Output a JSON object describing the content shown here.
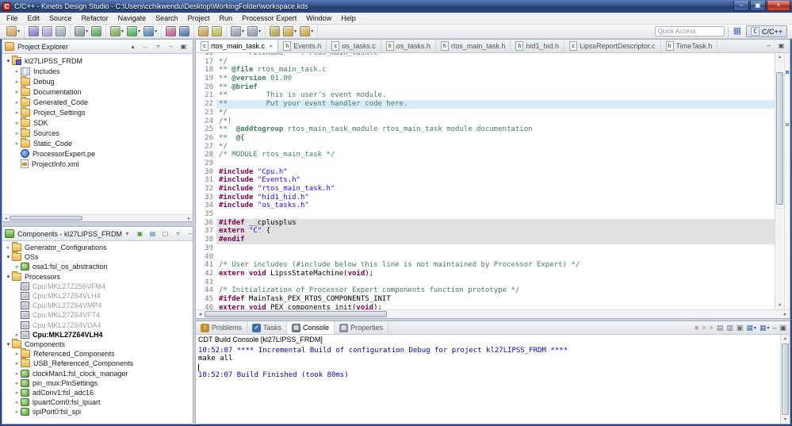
{
  "window": {
    "title": "C/C++ - Kinetis Design Studio - C:\\Users\\cchikwendu\\Desktop\\WorkingFolder\\workspace.kds",
    "app_icon": "C",
    "controls": {
      "minimize": "–",
      "maximize": "▣",
      "close": "×"
    }
  },
  "menu": {
    "items": [
      "File",
      "Edit",
      "Source",
      "Refactor",
      "Navigate",
      "Search",
      "Project",
      "Run",
      "Processor Expert",
      "Window",
      "Help"
    ]
  },
  "toolbar": {
    "quick_access_placeholder": "Quick Access",
    "perspective_label": "C/C++",
    "groups": [
      [
        {
          "name": "new-wizard-icon",
          "c": "#caa24b",
          "dd": true
        }
      ],
      [
        {
          "name": "save-icon",
          "c": "#8073c4"
        },
        {
          "name": "save-all-icon",
          "c": "#a59ad6"
        },
        {
          "name": "print-icon",
          "c": "#9aa5b5"
        }
      ],
      [
        {
          "name": "build-icon",
          "c": "#8b9098",
          "dd": true
        },
        {
          "name": "new-connection-icon",
          "c": "#55a055"
        }
      ],
      [
        {
          "name": "debug-icon",
          "c": "#74a84e",
          "dd": true
        },
        {
          "name": "run-icon",
          "c": "#43ae4d",
          "dd": true
        },
        {
          "name": "external-tools-icon",
          "c": "#4d7fb0",
          "dd": true
        }
      ],
      [
        {
          "name": "processor-expert-generate-icon",
          "c": "#b05a8c"
        },
        {
          "name": "search-icon",
          "c": "#4b6ea8"
        }
      ],
      [
        {
          "name": "open-element-icon",
          "c": "#c49a3f"
        },
        {
          "name": "mark-occurrences-icon",
          "c": "#b8b84a"
        }
      ],
      [
        {
          "name": "next-annotation-icon",
          "c": "#8a99aa",
          "dd": true
        },
        {
          "name": "previous-annotation-icon",
          "c": "#8a99aa",
          "dd": true
        }
      ],
      [
        {
          "name": "last-edit-location-icon",
          "c": "#b0a040"
        },
        {
          "name": "back-icon",
          "c": "#caa23f",
          "dd": true
        },
        {
          "name": "forward-icon",
          "c": "#caa23f",
          "dd": true
        }
      ]
    ]
  },
  "project_explorer": {
    "title": "Project Explorer",
    "header_icons": [
      {
        "name": "collapse-all-icon",
        "glyph": "▴",
        "c": "#556"
      },
      {
        "name": "link-with-editor-icon",
        "glyph": "↔",
        "c": "#b9a23f"
      },
      {
        "name": "view-menu-icon",
        "glyph": "▿",
        "c": "#556"
      },
      {
        "name": "minimize-view-icon",
        "glyph": "–",
        "c": "#556"
      },
      {
        "name": "maximize-view-icon",
        "glyph": "▣",
        "c": "#556"
      }
    ],
    "items": [
      {
        "label": "kl27LIPSS_FRDM",
        "level": 0,
        "arrow": "expanded",
        "icon": "project"
      },
      {
        "label": "Includes",
        "level": 1,
        "arrow": "collapsed",
        "icon": "includes"
      },
      {
        "label": "Debug",
        "level": 1,
        "arrow": "collapsed",
        "icon": "folder"
      },
      {
        "label": "Documentation",
        "level": 1,
        "arrow": "collapsed",
        "icon": "folder"
      },
      {
        "label": "Generated_Code",
        "level": 1,
        "arrow": "collapsed",
        "icon": "folder"
      },
      {
        "label": "Project_Settings",
        "level": 1,
        "arrow": "collapsed",
        "icon": "folder"
      },
      {
        "label": "SDK",
        "level": 1,
        "arrow": "collapsed",
        "icon": "folder"
      },
      {
        "label": "Sources",
        "level": 1,
        "arrow": "collapsed",
        "icon": "folder"
      },
      {
        "label": "Static_Code",
        "level": 1,
        "arrow": "collapsed",
        "icon": "folder"
      },
      {
        "label": "ProcessorExpert.pe",
        "level": 1,
        "arrow": "none",
        "icon": "pe"
      },
      {
        "label": "ProjectInfo.xml",
        "level": 1,
        "arrow": "none",
        "icon": "xml"
      }
    ]
  },
  "components_view": {
    "title": "Components - kl27LIPSS_FRDM",
    "header_icons": [
      {
        "name": "filter-components-icon",
        "glyph": "▾",
        "c": "#777"
      },
      {
        "name": "component-mode-icon",
        "glyph": "▣",
        "c": "#4a8f3f"
      },
      {
        "name": "code-generation-icon",
        "glyph": "▤",
        "c": "#3f6fa8"
      },
      {
        "name": "refresh-components-icon",
        "glyph": "▢",
        "c": "#a8673f"
      },
      {
        "name": "view-menu-icon",
        "glyph": "▿",
        "c": "#556"
      },
      {
        "name": "minimize-view-icon",
        "glyph": "–",
        "c": "#556"
      },
      {
        "name": "maximize-view-icon",
        "glyph": "▣",
        "c": "#556"
      }
    ],
    "items": [
      {
        "label": "Generator_Configurations",
        "level": 0,
        "arrow": "collapsed",
        "icon": "folder"
      },
      {
        "label": "OSs",
        "level": 0,
        "arrow": "expanded",
        "icon": "folder"
      },
      {
        "label": "osa1:fsl_os_abstraction",
        "level": 1,
        "arrow": "collapsed",
        "icon": "component"
      },
      {
        "label": "Processors",
        "level": 0,
        "arrow": "expanded",
        "icon": "folder"
      },
      {
        "label": "Cpu:MKL27Z256VFM4",
        "level": 1,
        "arrow": "none",
        "icon": "cpu",
        "gray": true
      },
      {
        "label": "Cpu:MKL27Z64VLH4",
        "level": 1,
        "arrow": "none",
        "icon": "cpu",
        "gray": true
      },
      {
        "label": "Cpu:MKL27Z64VMP4",
        "level": 1,
        "arrow": "none",
        "icon": "cpu",
        "gray": true
      },
      {
        "label": "Cpu:MKL27Z64VFT4",
        "level": 1,
        "arrow": "none",
        "icon": "cpu",
        "gray": true
      },
      {
        "label": "Cpu:MKL27Z64VDA4",
        "level": 1,
        "arrow": "none",
        "icon": "cpu",
        "gray": true
      },
      {
        "label": "Cpu:MKL27Z64VLH4",
        "level": 1,
        "arrow": "collapsed",
        "icon": "cpu",
        "bold": true
      },
      {
        "label": "Components",
        "level": 0,
        "arrow": "expanded",
        "icon": "folder"
      },
      {
        "label": "Referenced_Components",
        "level": 1,
        "arrow": "collapsed",
        "icon": "folder"
      },
      {
        "label": "USB_Referenced_Components",
        "level": 1,
        "arrow": "collapsed",
        "icon": "folder"
      },
      {
        "label": "clockMan1:fsl_clock_manager",
        "level": 1,
        "arrow": "collapsed",
        "icon": "component"
      },
      {
        "label": "pin_mux:PinSettings",
        "level": 1,
        "arrow": "collapsed",
        "icon": "component"
      },
      {
        "label": "adConv1:fsl_adc16",
        "level": 1,
        "arrow": "collapsed",
        "icon": "component"
      },
      {
        "label": "lpuartCom0:fsl_lpuart",
        "level": 1,
        "arrow": "collapsed",
        "icon": "component"
      },
      {
        "label": "spiPort0:fsl_spi",
        "level": 1,
        "arrow": "collapsed",
        "icon": "component"
      }
    ]
  },
  "editor": {
    "header_icons": [
      {
        "name": "minimize-editor-icon",
        "glyph": "–",
        "c": "#556"
      },
      {
        "name": "maximize-editor-icon",
        "glyph": "▣",
        "c": "#556"
      }
    ],
    "tabs": [
      {
        "label": "rtos_main_task.c",
        "icon": "c",
        "active": true
      },
      {
        "label": "Events.h",
        "icon": "h"
      },
      {
        "label": "os_tasks.c",
        "icon": "c"
      },
      {
        "label": "os_tasks.h",
        "icon": "h"
      },
      {
        "label": "rtos_main_task.h",
        "icon": "h"
      },
      {
        "label": "hid1_hid.h",
        "icon": "h"
      },
      {
        "label": "LipssReportDescriptor.c",
        "icon": "c"
      },
      {
        "label": "TimeTask.h",
        "icon": "h"
      }
    ],
    "lines": [
      {
        "n": 16,
        "seg": [
          [
            "cm",
            "**     Filename    : rtos_main_task.c"
          ]
        ]
      },
      {
        "n": 17,
        "seg": [
          [
            "cm",
            "*/"
          ]
        ]
      },
      {
        "n": 18,
        "seg": [
          [
            "cm",
            "** "
          ],
          [
            "cmtag",
            "@file"
          ],
          [
            "cm",
            " rtos_main_task.c"
          ]
        ]
      },
      {
        "n": 19,
        "seg": [
          [
            "cm",
            "** "
          ],
          [
            "cmtag",
            "@version"
          ],
          [
            "cm",
            " 01.00"
          ]
        ]
      },
      {
        "n": 20,
        "seg": [
          [
            "cm",
            "** "
          ],
          [
            "cmtag",
            "@brief"
          ]
        ]
      },
      {
        "n": 21,
        "seg": [
          [
            "cm",
            "**         This is user's event module."
          ]
        ]
      },
      {
        "n": 22,
        "hl": "current",
        "seg": [
          [
            "cm",
            "**         Put your event handler code here."
          ]
        ]
      },
      {
        "n": 23,
        "seg": [
          [
            "cm",
            "*/"
          ]
        ]
      },
      {
        "n": 24,
        "seg": [
          [
            "cm",
            "/*!"
          ]
        ]
      },
      {
        "n": 25,
        "seg": [
          [
            "cm",
            "**  "
          ],
          [
            "cmtag",
            "@addtogroup"
          ],
          [
            "cm",
            " rtos_main_task_module rtos_main_task module documentation"
          ]
        ]
      },
      {
        "n": 26,
        "seg": [
          [
            "cm",
            "**  "
          ],
          [
            "cmtag",
            "@{"
          ]
        ]
      },
      {
        "n": 27,
        "seg": [
          [
            "cm",
            "*/"
          ]
        ]
      },
      {
        "n": 28,
        "seg": [
          [
            "cm",
            "/* MODULE rtos_main_task */"
          ]
        ]
      },
      {
        "n": 29,
        "seg": []
      },
      {
        "n": 30,
        "seg": [
          [
            "dir",
            "#include"
          ],
          [
            "pl",
            " "
          ],
          [
            "str",
            "\"Cpu.h\""
          ]
        ]
      },
      {
        "n": 31,
        "seg": [
          [
            "dir",
            "#include"
          ],
          [
            "pl",
            " "
          ],
          [
            "str",
            "\"Events.h\""
          ]
        ]
      },
      {
        "n": 32,
        "seg": [
          [
            "dir",
            "#include"
          ],
          [
            "pl",
            " "
          ],
          [
            "str",
            "\"rtos_main_task.h\""
          ]
        ]
      },
      {
        "n": 33,
        "seg": [
          [
            "dir",
            "#include"
          ],
          [
            "pl",
            " "
          ],
          [
            "str",
            "\"hid1_hid.h\""
          ]
        ]
      },
      {
        "n": 34,
        "seg": [
          [
            "dir",
            "#include"
          ],
          [
            "pl",
            " "
          ],
          [
            "str",
            "\"os_tasks.h\""
          ]
        ]
      },
      {
        "n": 35,
        "seg": []
      },
      {
        "n": 36,
        "hl": "inactive",
        "seg": [
          [
            "dir",
            "#ifdef"
          ],
          [
            "pl",
            " __cplusplus"
          ]
        ]
      },
      {
        "n": 37,
        "hl": "inactive",
        "seg": [
          [
            "kw",
            "extern"
          ],
          [
            "pl",
            " "
          ],
          [
            "str",
            "\"C\""
          ],
          [
            "pl",
            " {"
          ]
        ]
      },
      {
        "n": 38,
        "hl": "inactive",
        "seg": [
          [
            "dir",
            "#endif"
          ]
        ]
      },
      {
        "n": 39,
        "seg": []
      },
      {
        "n": 40,
        "seg": []
      },
      {
        "n": 41,
        "seg": [
          [
            "cm",
            "/* User includes (#include below this line is not maintained by Processor Expert) */"
          ]
        ]
      },
      {
        "n": 42,
        "seg": [
          [
            "kw",
            "extern"
          ],
          [
            "pl",
            " "
          ],
          [
            "kw",
            "void"
          ],
          [
            "pl",
            " LipssStateMachine("
          ],
          [
            "kw",
            "void"
          ],
          [
            "pl",
            ");"
          ]
        ]
      },
      {
        "n": 43,
        "seg": []
      },
      {
        "n": 44,
        "seg": [
          [
            "cm",
            "/* Initialization of Processor Expert components function prototype */"
          ]
        ]
      },
      {
        "n": 45,
        "seg": [
          [
            "dir",
            "#ifdef"
          ],
          [
            "pl",
            " MainTask_PEX_RTOS_COMPONENTS_INIT"
          ]
        ]
      },
      {
        "n": 46,
        "seg": [
          [
            "kw",
            "extern"
          ],
          [
            "pl",
            " "
          ],
          [
            "kw",
            "void"
          ],
          [
            "pl",
            " PEX_components_init("
          ],
          [
            "kw",
            "void"
          ],
          [
            "pl",
            ");"
          ]
        ]
      }
    ]
  },
  "console": {
    "label": "CDT Build Console [kl27LIPSS_FRDM]",
    "tabs": [
      {
        "label": "Problems",
        "glyph": "!",
        "c": "#c98f2f"
      },
      {
        "label": "Tasks",
        "glyph": "✓",
        "c": "#3f6fa8"
      },
      {
        "label": "Console",
        "glyph": "▤",
        "c": "#6d7683",
        "active": true
      },
      {
        "label": "Properties",
        "glyph": "▤",
        "c": "#8a8f98"
      }
    ],
    "toolbar": [
      {
        "name": "terminate-icon",
        "glyph": "■",
        "c": "#c9a6a6"
      },
      {
        "name": "remove-launch-icon",
        "glyph": "×",
        "c": "#8a8f98"
      },
      {
        "name": "remove-all-launches-icon",
        "glyph": "×",
        "c": "#8a8f98"
      },
      {
        "name": "clear-console-icon",
        "glyph": "▤",
        "c": "#6d7683"
      },
      {
        "name": "scroll-lock-icon",
        "glyph": "▥",
        "c": "#6d7683"
      },
      {
        "name": "pin-console-icon",
        "glyph": "▣",
        "c": "#6d7683"
      },
      {
        "name": "display-selected-console-icon",
        "glyph": "▦",
        "c": "#4a6ea9",
        "dd": true
      },
      {
        "name": "open-console-icon",
        "glyph": "▦",
        "c": "#4a6ea9",
        "dd": true
      },
      {
        "name": "minimize-view-icon",
        "glyph": "–",
        "c": "#556"
      },
      {
        "name": "maximize-view-icon",
        "glyph": "▣",
        "c": "#556"
      }
    ],
    "lines": [
      {
        "type": "info",
        "text": "10:52:07 **** Incremental Build of configuration Debug for project kl27LIPSS_FRDM ****"
      },
      {
        "type": "out",
        "text": "make all "
      },
      {
        "type": "out",
        "text": "",
        "caret": true
      },
      {
        "type": "info",
        "text": "10:52:07 Build Finished (took 80ms)"
      }
    ]
  }
}
